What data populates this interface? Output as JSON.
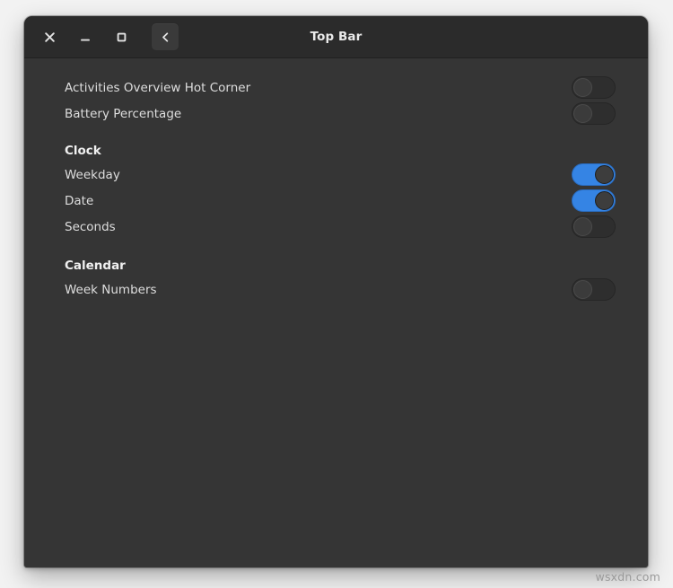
{
  "window": {
    "title": "Top Bar",
    "controls": [
      {
        "name": "close-button",
        "glyph": "close-icon",
        "label": "Close"
      },
      {
        "name": "minimize-button",
        "glyph": "minimize-icon",
        "label": "Minimize"
      },
      {
        "name": "maximize-button",
        "glyph": "maximize-icon",
        "label": "Maximize"
      }
    ],
    "back_button": {
      "label": "Back",
      "icon": "chevron-left-icon"
    }
  },
  "colors": {
    "accent_on": "#3584e4",
    "titlebar_bg": "#2b2b2b",
    "content_bg": "#353535",
    "switch_off_bg": "#2e2e2e",
    "text_primary": "#dedede",
    "text_heading": "#f0f0f0"
  },
  "settings": {
    "top_rows": [
      {
        "label": "Activities Overview Hot Corner",
        "state": "off",
        "state_label": "Off"
      },
      {
        "label": "Battery Percentage",
        "state": "off",
        "state_label": "Off"
      }
    ],
    "sections": [
      {
        "heading": "Clock",
        "rows": [
          {
            "label": "Weekday",
            "state": "on",
            "state_label": "On"
          },
          {
            "label": "Date",
            "state": "on",
            "state_label": "On"
          },
          {
            "label": "Seconds",
            "state": "off",
            "state_label": "Off"
          }
        ]
      },
      {
        "heading": "Calendar",
        "rows": [
          {
            "label": "Week Numbers",
            "state": "off",
            "state_label": "Off"
          }
        ]
      }
    ]
  },
  "watermark": "wsxdn.com"
}
